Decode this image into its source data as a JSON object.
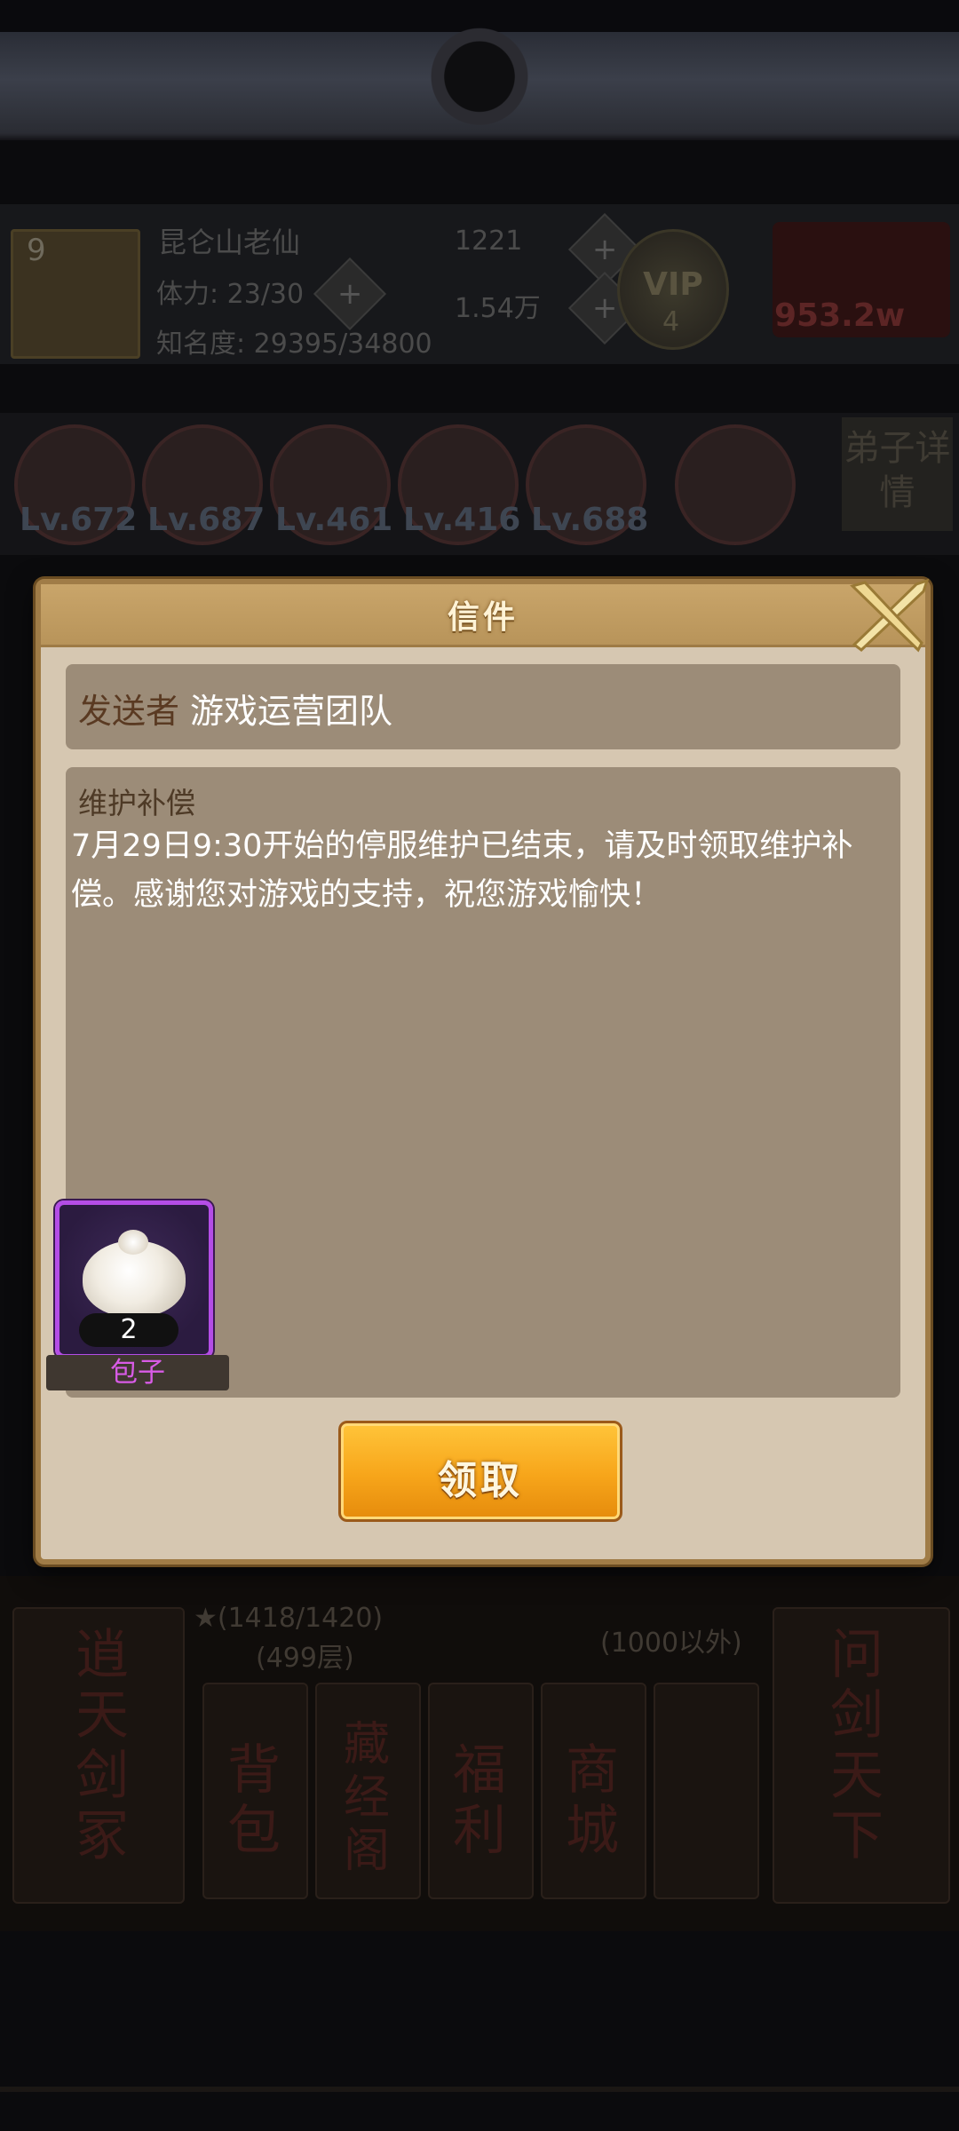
{
  "background": {
    "player": {
      "level": "9",
      "name": "昆仑山老仙",
      "stamina": "体力: 23/30",
      "fame": "知名度: 29395/34800",
      "currency_a": "1221",
      "currency_b": "1.54万",
      "vip": "VIP",
      "vip_level": "4",
      "power": "953.2w"
    },
    "disciples": [
      {
        "level": "Lv.672"
      },
      {
        "level": "Lv.687"
      },
      {
        "level": "Lv.461"
      },
      {
        "level": "Lv.416"
      },
      {
        "level": "Lv.688"
      }
    ],
    "side_tab": "弟子详情",
    "bottom": {
      "left_card": "逍天剑冢",
      "right_card": "问剑天下",
      "star_progress": "★(1418/1420)",
      "floor": "(499层)",
      "limit": "(1000以外)",
      "buttons": [
        {
          "label": "背包"
        },
        {
          "label": "藏经阁"
        },
        {
          "label": "福利"
        },
        {
          "label": "商城"
        }
      ]
    }
  },
  "dialog": {
    "title": "信件",
    "sender_label": "发送者",
    "sender_value": "游戏运营团队",
    "subject": "维护补偿",
    "content": "7月29日9:30开始的停服维护已结束，请及时领取维护补偿。感谢您对游戏的支持，祝您游戏愉快！",
    "attachment": {
      "name": "包子",
      "count": "2",
      "rarity_color": "#b44de6"
    },
    "claim_button": "领取"
  }
}
